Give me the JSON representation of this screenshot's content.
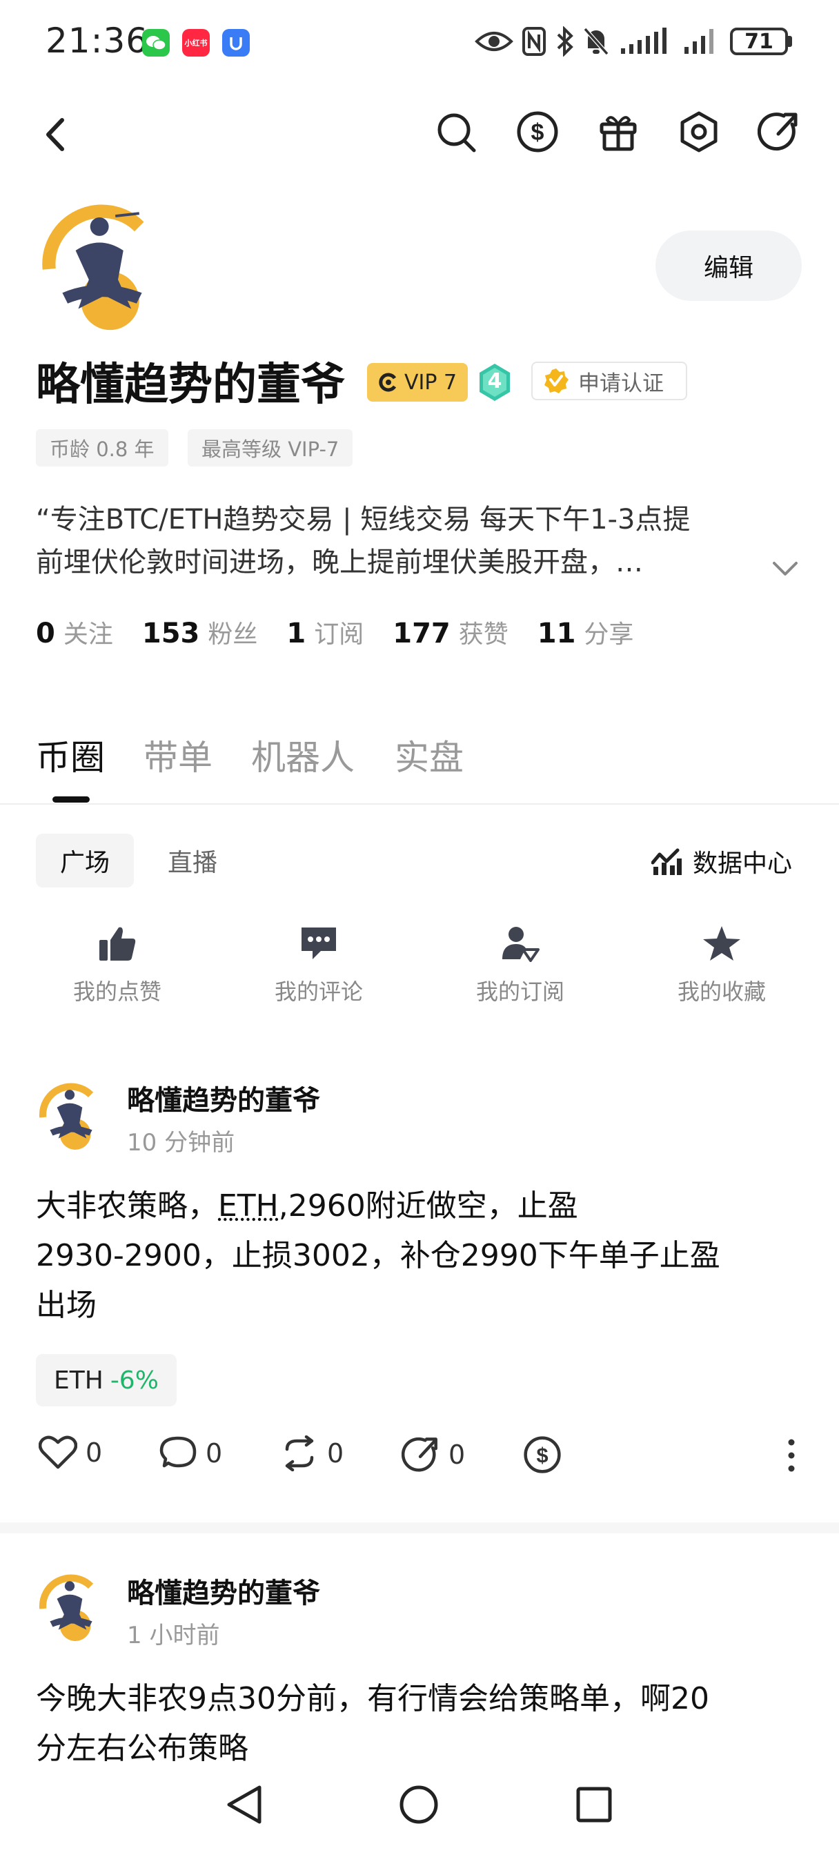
{
  "status_bar": {
    "time": "21:36",
    "apps": [
      {
        "name": "wechat-icon",
        "color": "#2ac74a"
      },
      {
        "name": "xiaohongshu-icon",
        "label": "小红书",
        "color": "#ff2741"
      },
      {
        "name": "app-shield-icon",
        "color": "#3a7bf6"
      }
    ],
    "battery": "71"
  },
  "header": {
    "back_icon": "chevron-left-icon",
    "actions": [
      "search-icon",
      "dollar-circle-icon",
      "gift-icon",
      "hexagon-settings-icon",
      "share-icon"
    ]
  },
  "profile": {
    "edit_label": "编辑",
    "name": "略懂趋势的董爷",
    "vip": "VIP 7",
    "level": "4",
    "verify_label": "申请认证",
    "tags": [
      "币龄 0.8 年",
      "最高等级 VIP-7"
    ],
    "bio_line1": "“专注BTC/ETH趋势交易 | 短线交易 每天下午1-3点提",
    "bio_line2": "前埋伏伦敦时间进场，晚上提前埋伏美股开盘，…",
    "stats": [
      {
        "num": "0",
        "label": "关注"
      },
      {
        "num": "153",
        "label": "粉丝"
      },
      {
        "num": "1",
        "label": "订阅"
      },
      {
        "num": "177",
        "label": "获赞"
      },
      {
        "num": "11",
        "label": "分享"
      }
    ]
  },
  "tabs": [
    "币圈",
    "带单",
    "机器人",
    "实盘"
  ],
  "sub_tabs": [
    "广场",
    "直播"
  ],
  "data_center_label": "数据中心",
  "quick_actions": [
    {
      "icon": "thumbs-up-icon",
      "label": "我的点赞"
    },
    {
      "icon": "comment-icon",
      "label": "我的评论"
    },
    {
      "icon": "subscribe-user-icon",
      "label": "我的订阅"
    },
    {
      "icon": "star-icon",
      "label": "我的收藏"
    }
  ],
  "posts": [
    {
      "author": "略懂趋势的董爷",
      "time": "10 分钟前",
      "line1_pre": "大非农策略，",
      "line1_coin": "ETH",
      "line1_post": ",2960附近做空，止盈",
      "line2": "2930-2900，止损3002，补仓2990下午单子止盈",
      "line3": "出场",
      "coin": "ETH",
      "change": "-6%",
      "change_color": "#1fb66b",
      "likes": "0",
      "comments": "0",
      "reposts": "0",
      "shares": "0"
    },
    {
      "author": "略懂趋势的董爷",
      "time": "1 小时前",
      "line1": "今晚大非农9点30分前，有行情会给策略单，啊20",
      "line2": "分左右公布策略"
    }
  ]
}
